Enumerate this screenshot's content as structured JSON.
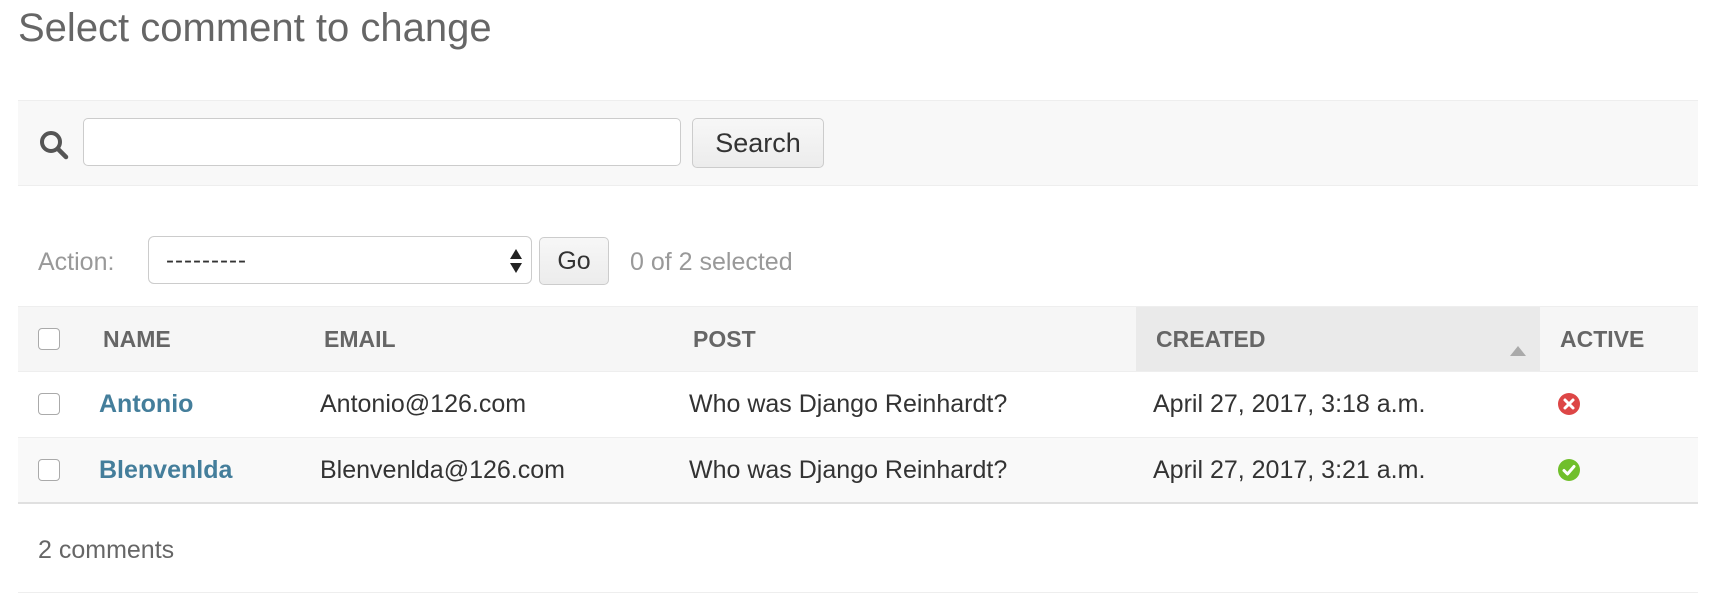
{
  "page": {
    "title": "Select comment to change"
  },
  "search": {
    "value": "",
    "placeholder": "",
    "button_label": "Search",
    "icon": "search-icon"
  },
  "actions": {
    "label": "Action:",
    "selected_option": "---------",
    "go_label": "Go",
    "selection_counter": "0 of 2 selected"
  },
  "table": {
    "columns": [
      {
        "key": "name",
        "label": "Name"
      },
      {
        "key": "email",
        "label": "Email"
      },
      {
        "key": "post",
        "label": "Post"
      },
      {
        "key": "created",
        "label": "Created",
        "sorted": "ascending"
      },
      {
        "key": "active",
        "label": "Active"
      }
    ],
    "rows": [
      {
        "name": "Antonio",
        "email": "Antonio@126.com",
        "post": "Who was Django Reinhardt?",
        "created": "April 27, 2017, 3:18 a.m.",
        "active": false
      },
      {
        "name": "Blenvenlda",
        "email": "Blenvenlda@126.com",
        "post": "Who was Django Reinhardt?",
        "created": "April 27, 2017, 3:21 a.m.",
        "active": true
      }
    ]
  },
  "footer": {
    "count_text": "2 comments"
  },
  "colors": {
    "link": "#447e9b",
    "inactive": "#dd4646",
    "active": "#70bf2b",
    "muted_text": "#999999"
  }
}
